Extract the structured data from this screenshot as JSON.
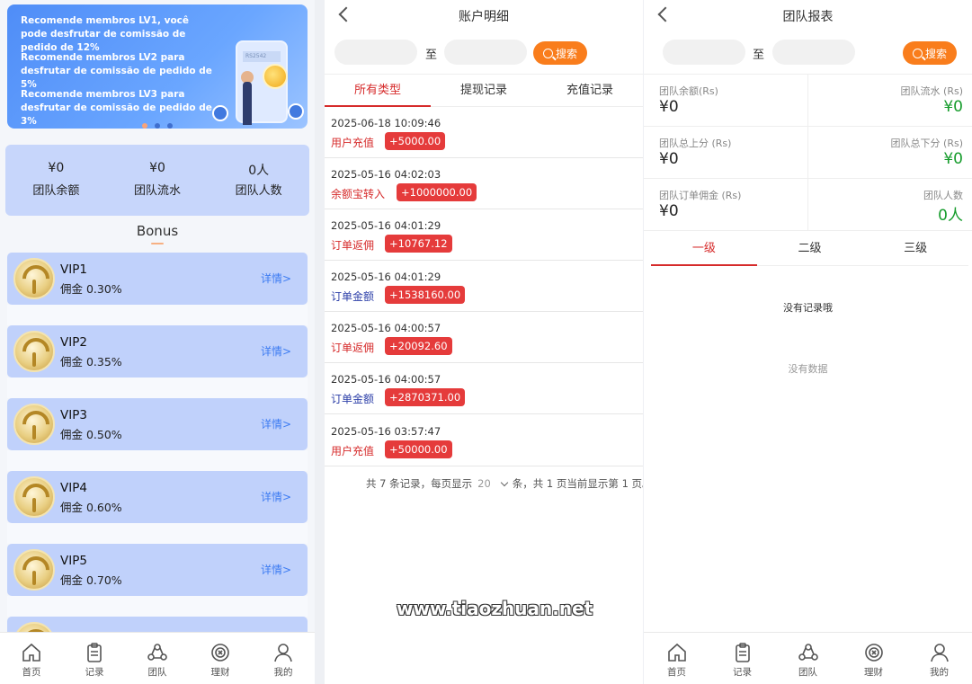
{
  "home": {
    "banner": {
      "lines": [
        "Recomende membros LV1, você pode desfrutar de comissão de pedido de 12%",
        "Recomende membros LV2 para desfrutar de comissão de pedido de 5%",
        "Recomende membros LV3 para desfrutar de comissão de pedido de 3%"
      ],
      "phone_text": "RS2542"
    },
    "stats": [
      {
        "value": "¥0",
        "label": "团队余额"
      },
      {
        "value": "¥0",
        "label": "团队流水"
      },
      {
        "value": "0人",
        "label": "团队人数"
      }
    ],
    "bonus_title": "Bonus",
    "vips": [
      {
        "name": "VIP1",
        "rate": "佣金 0.30%",
        "detail": "详情>"
      },
      {
        "name": "VIP2",
        "rate": "佣金 0.35%",
        "detail": "详情>"
      },
      {
        "name": "VIP3",
        "rate": "佣金 0.50%",
        "detail": "详情>"
      },
      {
        "name": "VIP4",
        "rate": "佣金 0.60%",
        "detail": "详情>"
      },
      {
        "name": "VIP5",
        "rate": "佣金 0.70%",
        "detail": "详情>"
      }
    ]
  },
  "tabbar": [
    {
      "label": "首页",
      "icon": "home-icon"
    },
    {
      "label": "记录",
      "icon": "records-icon"
    },
    {
      "label": "团队",
      "icon": "team-icon"
    },
    {
      "label": "理财",
      "icon": "finance-icon"
    },
    {
      "label": "我的",
      "icon": "profile-icon"
    }
  ],
  "account": {
    "title": "账户明细",
    "to_label": "至",
    "search_label": "搜索",
    "filters": [
      "所有类型",
      "提现记录",
      "充值记录"
    ],
    "records": [
      {
        "time": "2025-06-18 10:09:46",
        "type": "用户充值",
        "amount": "+5000.00",
        "type_color": "#d62b2b"
      },
      {
        "time": "2025-05-16 04:02:03",
        "type": "余额宝转入",
        "amount": "+1000000.00",
        "type_color": "#d62b2b"
      },
      {
        "time": "2025-05-16 04:01:29",
        "type": "订单返佣",
        "amount": "+10767.12",
        "type_color": "#d62b2b"
      },
      {
        "time": "2025-05-16 04:01:29",
        "type": "订单金额",
        "amount": "+1538160.00",
        "type_color": "#2c3fa8"
      },
      {
        "time": "2025-05-16 04:00:57",
        "type": "订单返佣",
        "amount": "+20092.60",
        "type_color": "#d62b2b"
      },
      {
        "time": "2025-05-16 04:00:57",
        "type": "订单金额",
        "amount": "+2870371.00",
        "type_color": "#2c3fa8"
      },
      {
        "time": "2025-05-16 03:57:47",
        "type": "用户充值",
        "amount": "+50000.00",
        "type_color": "#d62b2b"
      }
    ],
    "pager": {
      "prefix": "共 7 条记录，每页显示",
      "page_size": "20",
      "suffix": "条，共 1 页当前显示第 1 页。"
    }
  },
  "team": {
    "title": "团队报表",
    "to_label": "至",
    "search_label": "搜索",
    "cells": [
      {
        "label": "团队余额(Rs)",
        "value": "¥0"
      },
      {
        "label": "团队流水 (Rs)",
        "value": "¥0"
      },
      {
        "label": "团队总上分 (Rs)",
        "value": "¥0"
      },
      {
        "label": "团队总下分 (Rs)",
        "value": "¥0"
      },
      {
        "label": "团队订单佣金 (Rs)",
        "value": "¥0"
      },
      {
        "label": "团队人数",
        "value": "0人"
      }
    ],
    "levels": [
      "一级",
      "二级",
      "三级"
    ],
    "empty_records": "没有记录哦",
    "empty_data": "没有数据"
  },
  "watermark": "www.tiaozhuan.net"
}
